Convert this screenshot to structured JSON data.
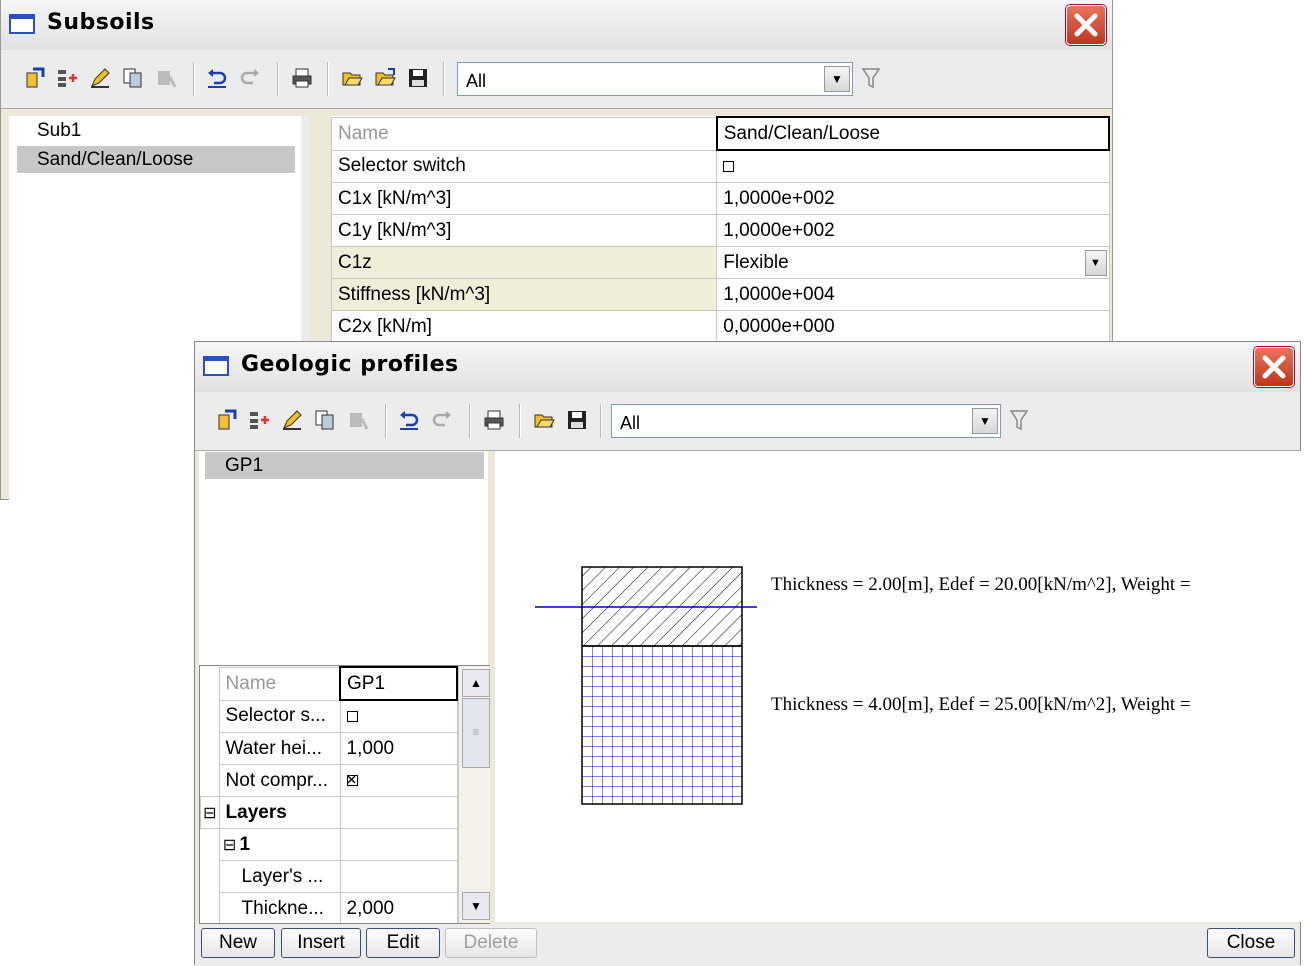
{
  "subsoils": {
    "title": "Subsoils",
    "filter_value": "All",
    "list": [
      "Sub1",
      "Sand/Clean/Loose"
    ],
    "properties": [
      {
        "name": "Name",
        "value": "Sand/Clean/Loose"
      },
      {
        "name": "Selector switch",
        "value": ""
      },
      {
        "name": "C1x [kN/m^3]",
        "value": "1,0000e+002"
      },
      {
        "name": "C1y [kN/m^3]",
        "value": "1,0000e+002"
      },
      {
        "name": "C1z",
        "value": "Flexible"
      },
      {
        "name": "Stiffness [kN/m^3]",
        "value": "1,0000e+004"
      },
      {
        "name": "C2x [kN/m]",
        "value": "0,0000e+000"
      }
    ]
  },
  "geologic": {
    "title": "Geologic profiles",
    "filter_value": "All",
    "list": [
      "GP1"
    ],
    "properties": [
      {
        "name": "Name",
        "value": "GP1"
      },
      {
        "name": "Selector s...",
        "value": ""
      },
      {
        "name": "Water hei...",
        "value": "1,000"
      },
      {
        "name": "Not compr...",
        "value": ""
      },
      {
        "name": "Layers",
        "value": ""
      },
      {
        "name": "1",
        "value": ""
      },
      {
        "name": "Layer's ...",
        "value": ""
      },
      {
        "name": "Thickne...",
        "value": "2,000"
      }
    ],
    "layer1_text": "Thickness  = 2.00[m], Edef = 20.00[kN/m^2], Weight =",
    "layer2_text": "Thickness  = 4.00[m], Edef = 25.00[kN/m^2], Weight =",
    "buttons": {
      "new": "New",
      "insert": "Insert",
      "edit": "Edit",
      "delete": "Delete",
      "close": "Close"
    },
    "colors": {
      "layer2_grid": "#0000cc",
      "water_line": "#0000cc"
    }
  }
}
